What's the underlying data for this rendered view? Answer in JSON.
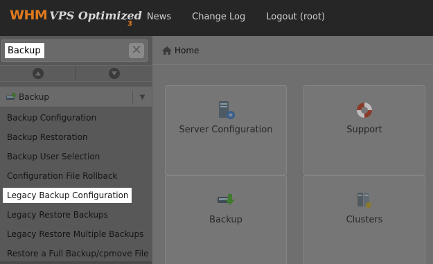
{
  "header": {
    "logo_main": "WHM",
    "logo_sub": "VPS Optimized",
    "logo_num": "3",
    "nav": [
      "News",
      "Change Log",
      "Logout (root)"
    ]
  },
  "sidebar": {
    "search": {
      "value": "Backup",
      "placeholder": ""
    },
    "category": "Backup",
    "items": [
      "Backup Configuration",
      "Backup Restoration",
      "Backup User Selection",
      "Configuration File Rollback",
      "Legacy Backup Configuration",
      "Legacy Restore Backups",
      "Legacy Restore Multiple Backups",
      "Restore a Full Backup/cpmove File"
    ],
    "active_index": 4
  },
  "main": {
    "breadcrumb": "Home",
    "tiles": [
      {
        "label": "Server Configuration",
        "icon": "server-configuration-icon"
      },
      {
        "label": "Support",
        "icon": "lifebuoy-icon"
      },
      {
        "label": "Backup",
        "icon": "backup-drive-icon"
      },
      {
        "label": "Clusters",
        "icon": "clusters-icon"
      }
    ]
  },
  "colors": {
    "accent": "#e07a1e",
    "header_bg": "#262626",
    "overlay_bg": "#6f6f6f",
    "highlight": "#ffffff"
  }
}
